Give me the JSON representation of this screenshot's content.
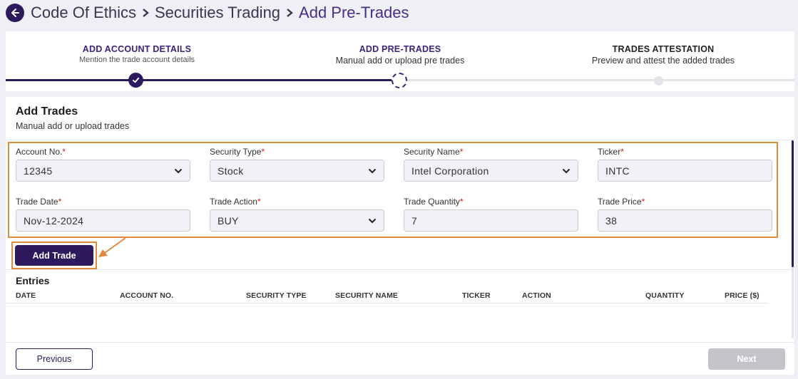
{
  "breadcrumb": {
    "items": [
      "Code Of Ethics",
      "Securities Trading",
      "Add Pre-Trades"
    ]
  },
  "stepper": {
    "steps": [
      {
        "title": "ADD ACCOUNT DETAILS",
        "subtitle": "Mention the trade account details",
        "state": "done"
      },
      {
        "title": "ADD PRE-TRADES",
        "subtitle": "Manual add or upload pre trades",
        "state": "current"
      },
      {
        "title": "TRADES ATTESTATION",
        "subtitle": "Preview and attest the added trades",
        "state": "pending"
      }
    ]
  },
  "card": {
    "title": "Add Trades",
    "subtitle": "Manual add or upload trades"
  },
  "form": {
    "account_no": {
      "label": "Account No.",
      "value": "12345"
    },
    "security_type": {
      "label": "Security Type",
      "value": "Stock"
    },
    "security_name": {
      "label": "Security Name",
      "value": "Intel Corporation"
    },
    "ticker": {
      "label": "Ticker",
      "value": "INTC"
    },
    "trade_date": {
      "label": "Trade Date",
      "value": "Nov-12-2024"
    },
    "trade_action": {
      "label": "Trade Action",
      "value": "BUY"
    },
    "trade_quantity": {
      "label": "Trade Quantity",
      "value": "7"
    },
    "trade_price": {
      "label": "Trade Price",
      "value": "38"
    },
    "required_mark": "*"
  },
  "actions": {
    "add_trade": "Add Trade",
    "previous": "Previous",
    "next": "Next"
  },
  "entries": {
    "title": "Entries",
    "columns": [
      "DATE",
      "ACCOUNT NO.",
      "SECURITY TYPE",
      "SECURITY NAME",
      "TICKER",
      "ACTION",
      "QUANTITY",
      "PRICE ($)"
    ]
  },
  "colors": {
    "brand": "#2d1a5c",
    "highlight": "#e08a3c",
    "required": "#d11a1a"
  }
}
